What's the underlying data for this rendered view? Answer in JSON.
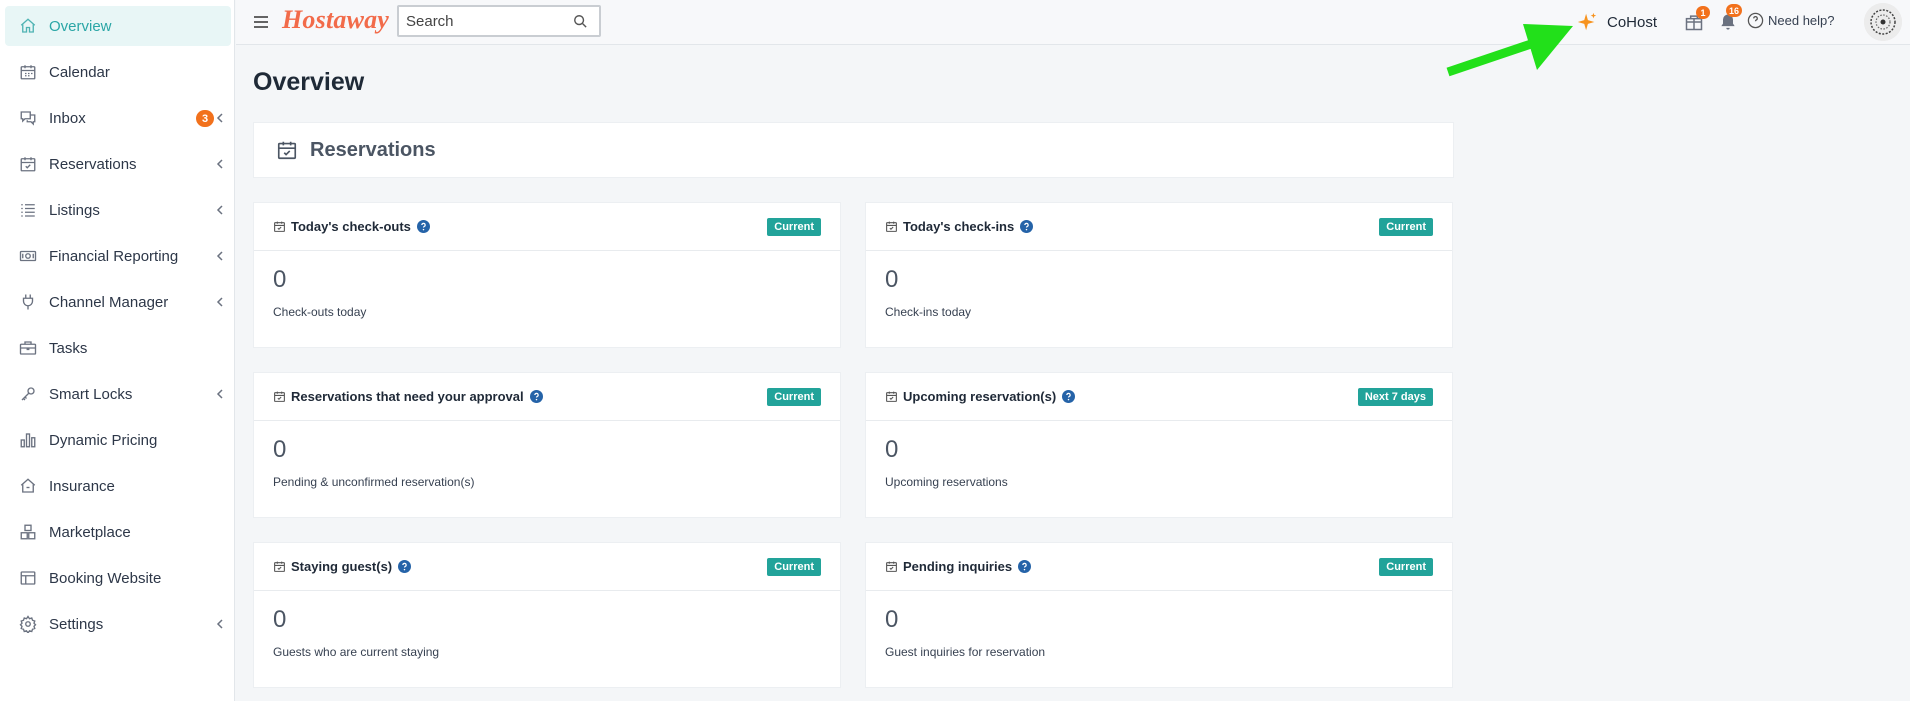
{
  "sidebar": {
    "items": [
      {
        "label": "Overview",
        "icon": "home-icon"
      },
      {
        "label": "Calendar",
        "icon": "calendar-icon"
      },
      {
        "label": "Inbox",
        "icon": "chat-icon",
        "badge": "3"
      },
      {
        "label": "Reservations",
        "icon": "calendar-check-icon"
      },
      {
        "label": "Listings",
        "icon": "list-icon"
      },
      {
        "label": "Financial Reporting",
        "icon": "money-icon"
      },
      {
        "label": "Channel Manager",
        "icon": "plug-icon"
      },
      {
        "label": "Tasks",
        "icon": "briefcase-icon"
      },
      {
        "label": "Smart Locks",
        "icon": "key-icon"
      },
      {
        "label": "Dynamic Pricing",
        "icon": "bar-chart-icon"
      },
      {
        "label": "Insurance",
        "icon": "house-shield-icon"
      },
      {
        "label": "Marketplace",
        "icon": "boxes-icon"
      },
      {
        "label": "Booking Website",
        "icon": "layout-icon"
      },
      {
        "label": "Settings",
        "icon": "gear-icon"
      }
    ]
  },
  "header": {
    "logo": "Hostaway",
    "search_placeholder": "Search",
    "cohost_label": "CoHost",
    "gift_badge": "1",
    "bell_badge": "16",
    "help_label": "Need help?"
  },
  "main": {
    "title": "Overview",
    "section_title": "Reservations",
    "cards": [
      {
        "title": "Today's check-outs",
        "tag": "Current",
        "value": "0",
        "desc": "Check-outs today"
      },
      {
        "title": "Today's check-ins",
        "tag": "Current",
        "value": "0",
        "desc": "Check-ins today"
      },
      {
        "title": "Reservations that need your approval",
        "tag": "Current",
        "value": "0",
        "desc": "Pending & unconfirmed reservation(s)"
      },
      {
        "title": "Upcoming reservation(s)",
        "tag": "Next 7 days",
        "value": "0",
        "desc": "Upcoming reservations"
      },
      {
        "title": "Staying guest(s)",
        "tag": "Current",
        "value": "0",
        "desc": "Guests who are current staying"
      },
      {
        "title": "Pending inquiries",
        "tag": "Current",
        "value": "0",
        "desc": "Guest inquiries for reservation"
      }
    ]
  },
  "colors": {
    "accent": "#2aa6a6",
    "tag": "#22a39a",
    "badge": "#f2711c",
    "logo": "#f26b4a",
    "annotation_arrow": "#22e01a"
  }
}
